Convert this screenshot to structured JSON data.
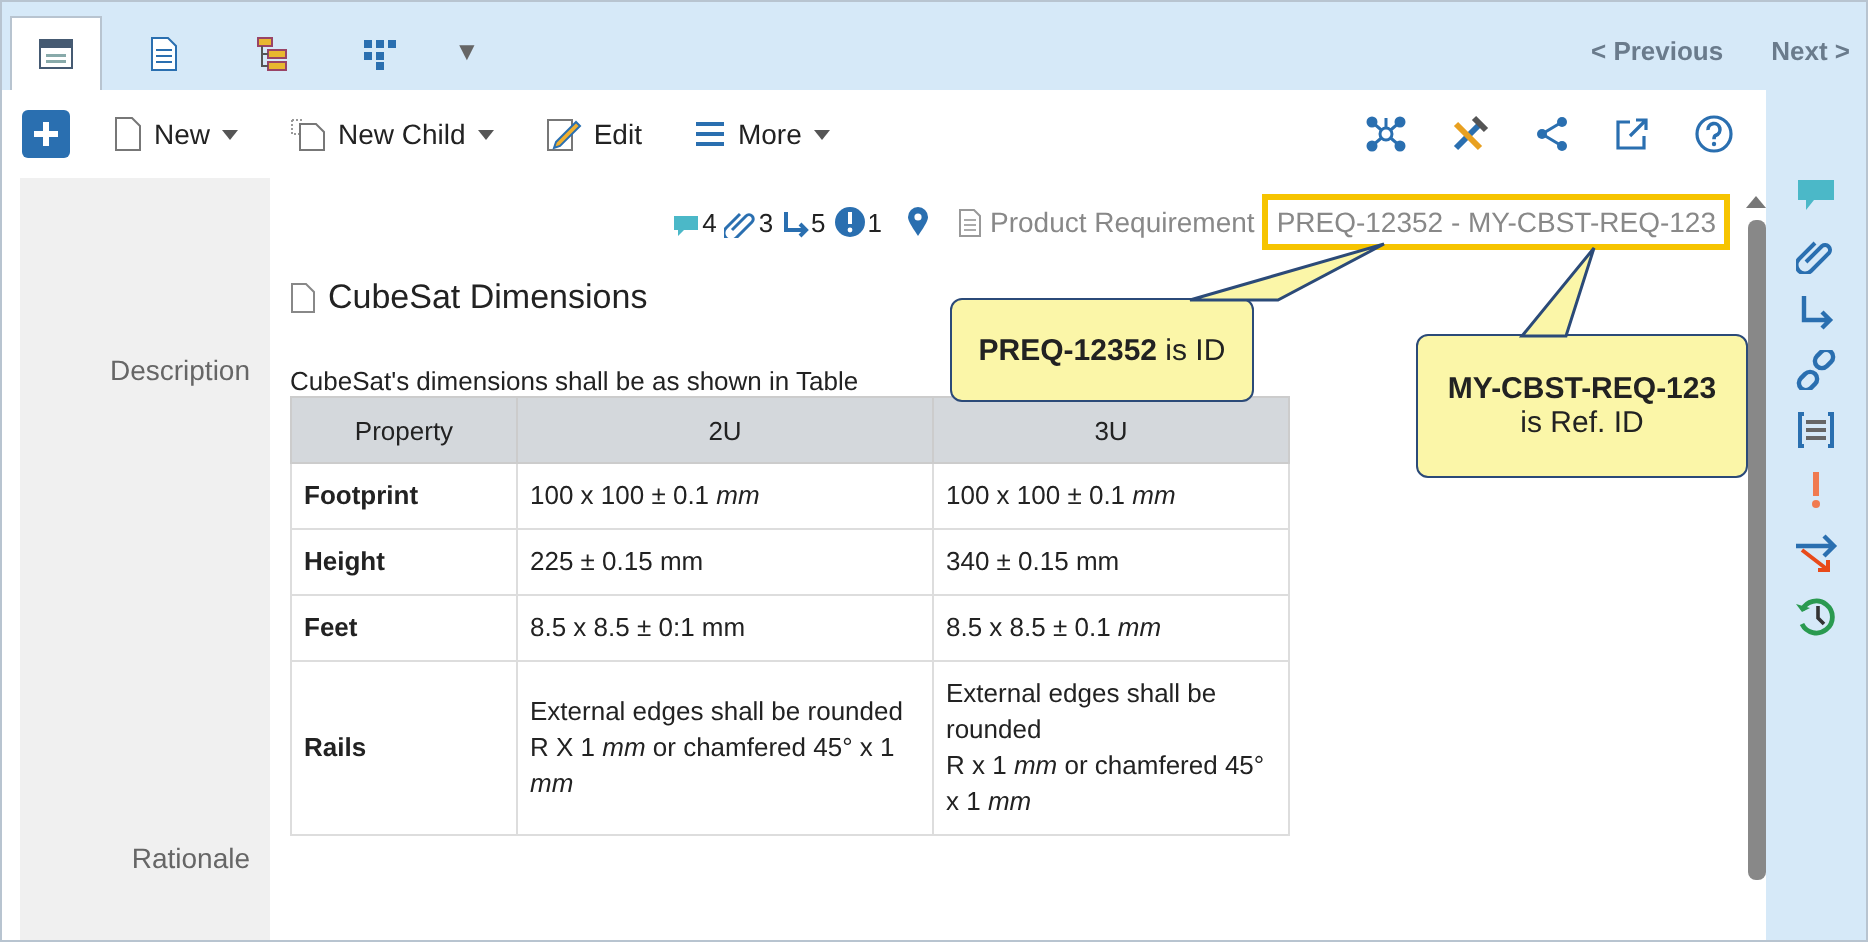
{
  "tabs": [
    {
      "selected": true
    },
    {
      "selected": false
    },
    {
      "selected": false
    },
    {
      "selected": false
    }
  ],
  "tab_menu": "▼",
  "nav": {
    "previous": "< Previous",
    "next": "Next >"
  },
  "toolbar": {
    "buttons": [
      {
        "label": "New",
        "kind": "new",
        "dropdown": true
      },
      {
        "label": "New Child",
        "kind": "child",
        "dropdown": true
      },
      {
        "label": "Edit",
        "kind": "edit",
        "dropdown": false
      },
      {
        "label": "More",
        "kind": "more",
        "dropdown": true
      }
    ]
  },
  "header": {
    "counts": [
      {
        "kind": "comment",
        "count": "4"
      },
      {
        "kind": "attachment",
        "count": "3"
      },
      {
        "kind": "trace",
        "count": "5"
      },
      {
        "kind": "issue",
        "count": "1"
      }
    ],
    "item_type": "Product Requirement",
    "item_id": "PREQ-12352 - MY-CBST-REQ-123"
  },
  "title": "CubeSat Dimensions",
  "fields": [
    {
      "label": "Description",
      "kind": "table"
    },
    {
      "label": "Rationale",
      "kind": "empty"
    }
  ],
  "description": {
    "intro": "CubeSat's dimensions shall be as shown in Table",
    "columns": [
      "Property",
      "2U",
      "3U"
    ],
    "rows": [
      [
        "Footprint",
        "100 x 100 ± 0.1 *mm*",
        "100 x 100 ± 0.1 *mm*"
      ],
      [
        "Height",
        "225 ± 0.15 mm",
        "340 ± 0.15 mm"
      ],
      [
        "Feet",
        "8.5 x 8.5 ± 0:1 mm",
        "8.5 x 8.5 ± 0.1 *mm*"
      ],
      [
        "Rails",
        "External edges shall be rounded R X 1 *mm* or chamfered 45° x 1 *mm*",
        "External edges shall be rounded\nR x 1 *mm* or chamfered 45° x 1 *mm*"
      ]
    ]
  },
  "callouts": [
    {
      "text": "**PREQ-12352** is ID"
    },
    {
      "text": "**MY-CBST-REQ-123**\nis Ref. ID"
    }
  ]
}
